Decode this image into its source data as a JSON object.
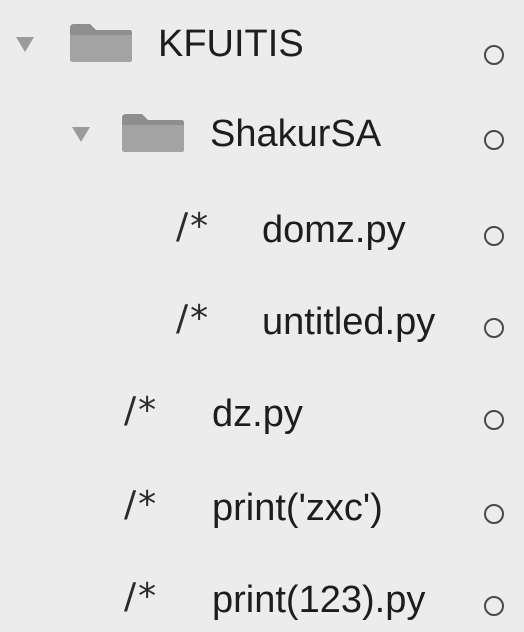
{
  "sidebar": {
    "items": [
      {
        "type": "folder",
        "label": "KFUITIS",
        "expanded": true,
        "icon": "folder-icon"
      },
      {
        "type": "folder",
        "label": "ShakurSA",
        "expanded": true,
        "icon": "folder-icon"
      },
      {
        "type": "file",
        "glyph": "/*",
        "label": "domz.py"
      },
      {
        "type": "file",
        "glyph": "/*",
        "label": "untitled.py"
      },
      {
        "type": "file",
        "glyph": "/*",
        "label": "dz.py"
      },
      {
        "type": "file",
        "glyph": "/*",
        "label": "print('zxc')"
      },
      {
        "type": "file",
        "glyph": "/*",
        "label": "print(123).py"
      }
    ]
  },
  "colors": {
    "background": "#ececec",
    "folder": "#8e8e8e",
    "text": "#1d1d1d",
    "disclosure": "#9b9b9b"
  }
}
